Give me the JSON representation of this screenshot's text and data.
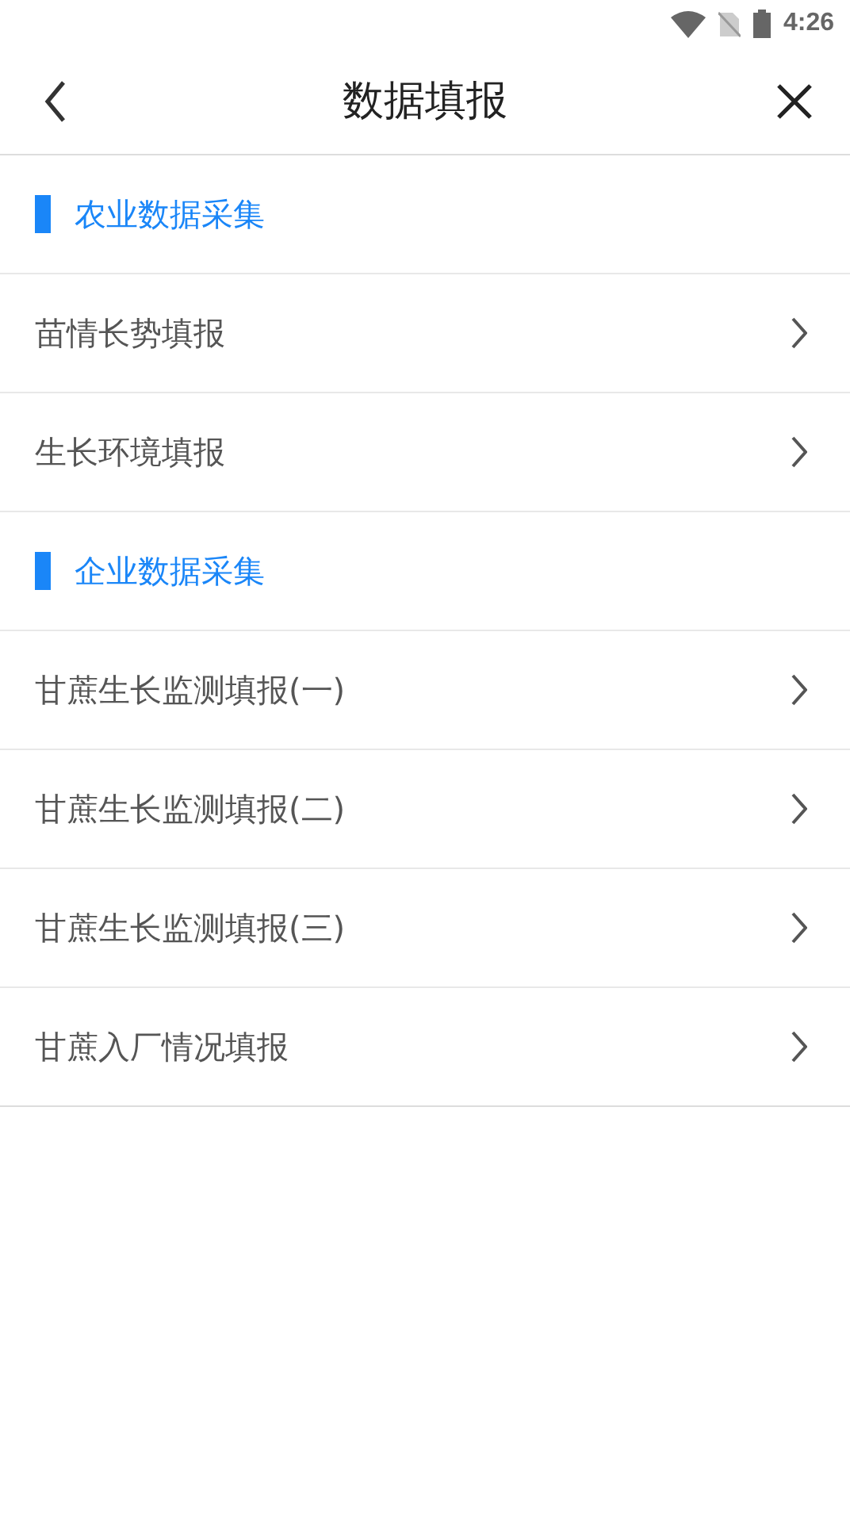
{
  "status_bar": {
    "time": "4:26"
  },
  "header": {
    "title": "数据填报"
  },
  "sections": [
    {
      "title": "农业数据采集",
      "items": [
        {
          "label": "苗情长势填报"
        },
        {
          "label": "生长环境填报"
        }
      ]
    },
    {
      "title": "企业数据采集",
      "items": [
        {
          "label": "甘蔗生长监测填报(一)"
        },
        {
          "label": "甘蔗生长监测填报(二)"
        },
        {
          "label": "甘蔗生长监测填报(三)"
        },
        {
          "label": "甘蔗入厂情况填报"
        }
      ]
    }
  ]
}
